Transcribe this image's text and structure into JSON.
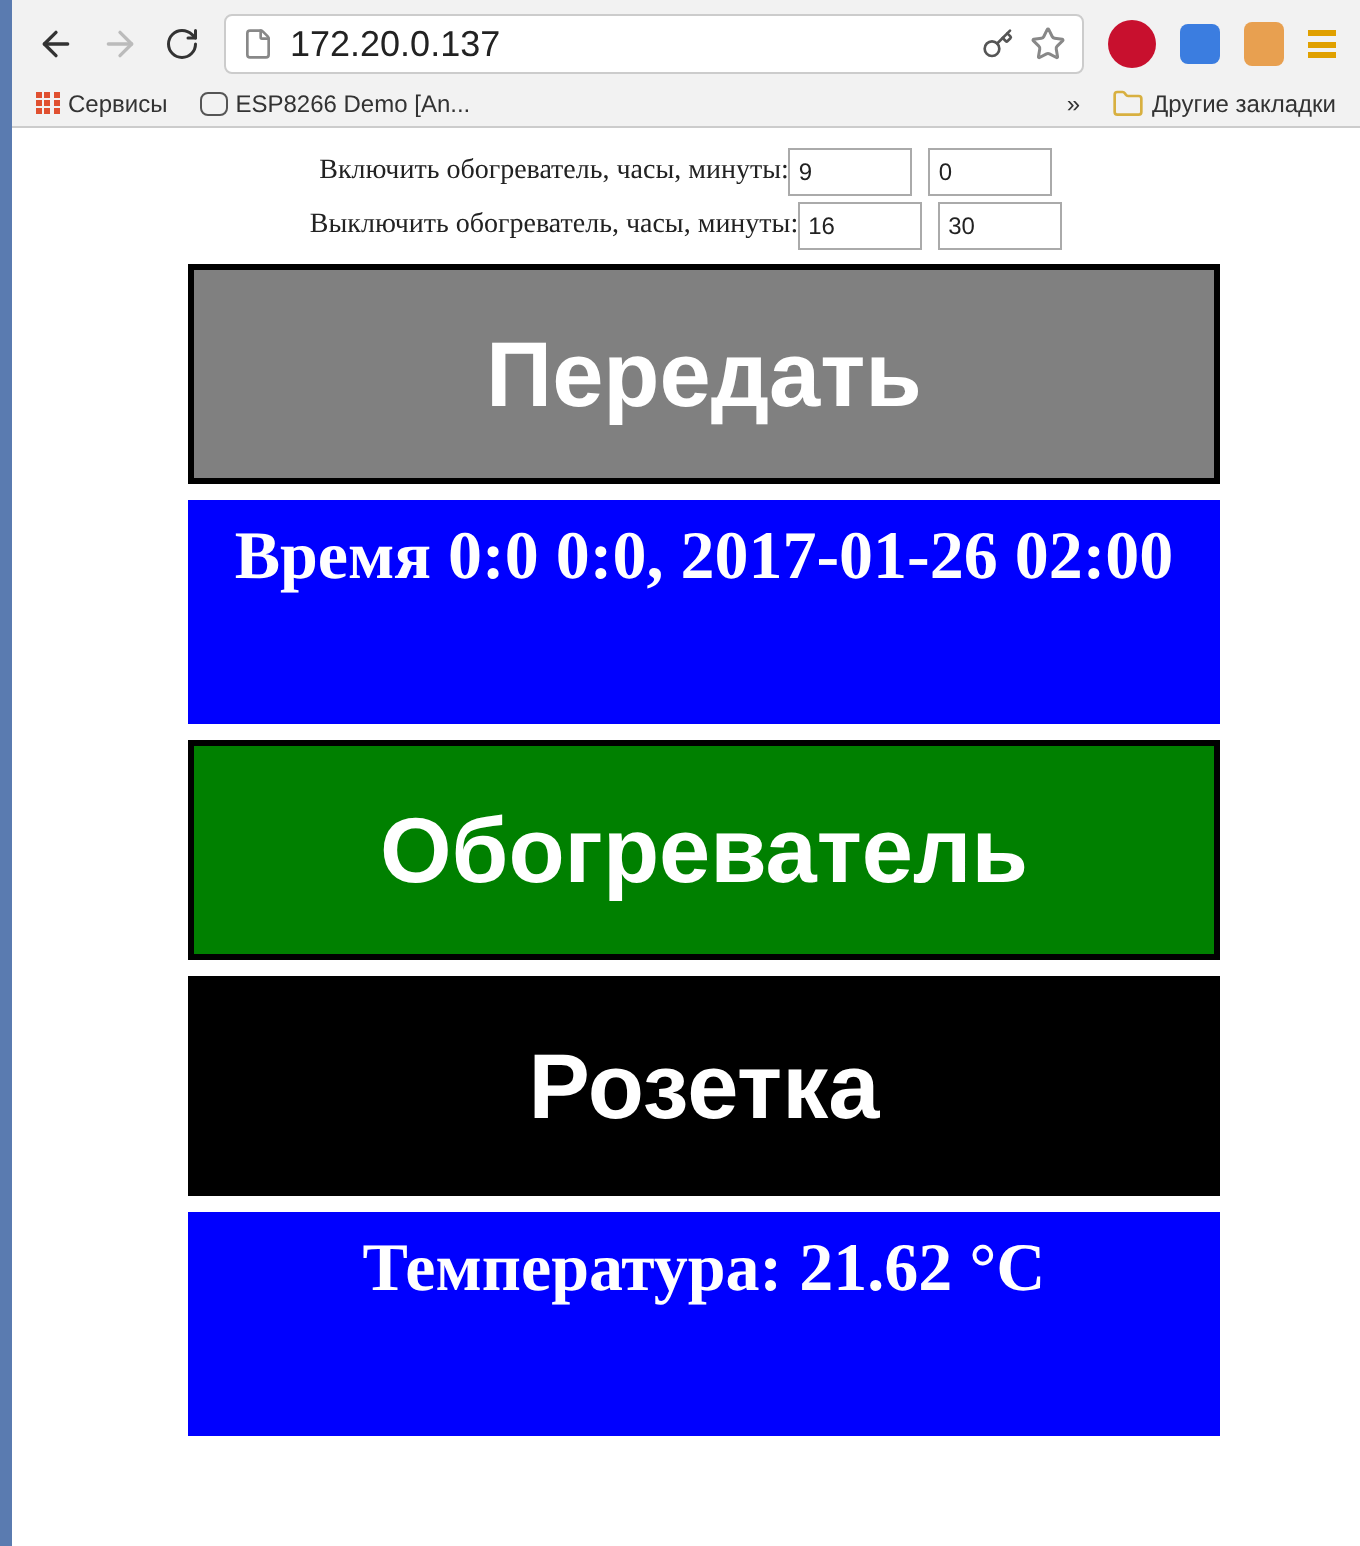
{
  "browser": {
    "address": "172.20.0.137",
    "bookmarks": [
      {
        "label": "Сервисы",
        "kind": "apps"
      },
      {
        "label": "ESP8266 Demo [An...",
        "kind": "page"
      }
    ],
    "overflow": "»",
    "other_bookmarks": "Другие закладки"
  },
  "form": {
    "rows": [
      {
        "label": "Включить обогреватель, часы, минуты:",
        "hours": "9",
        "minutes": "0"
      },
      {
        "label": "Выключить обогреватель, часы, минуты:",
        "hours": "16",
        "minutes": "30"
      }
    ]
  },
  "blocks": [
    {
      "text": "Передать",
      "kind": "button",
      "color": "#808080"
    },
    {
      "text": "Время 0:0 0:0, 2017-01-26 02:00",
      "kind": "info",
      "color": "#0000ff"
    },
    {
      "text": "Обогреватель",
      "kind": "button",
      "color": "#008000"
    },
    {
      "text": "Розетка",
      "kind": "button",
      "color": "#000000"
    },
    {
      "text": "Температура: 21.62 °C",
      "kind": "info",
      "color": "#0000ff"
    }
  ]
}
